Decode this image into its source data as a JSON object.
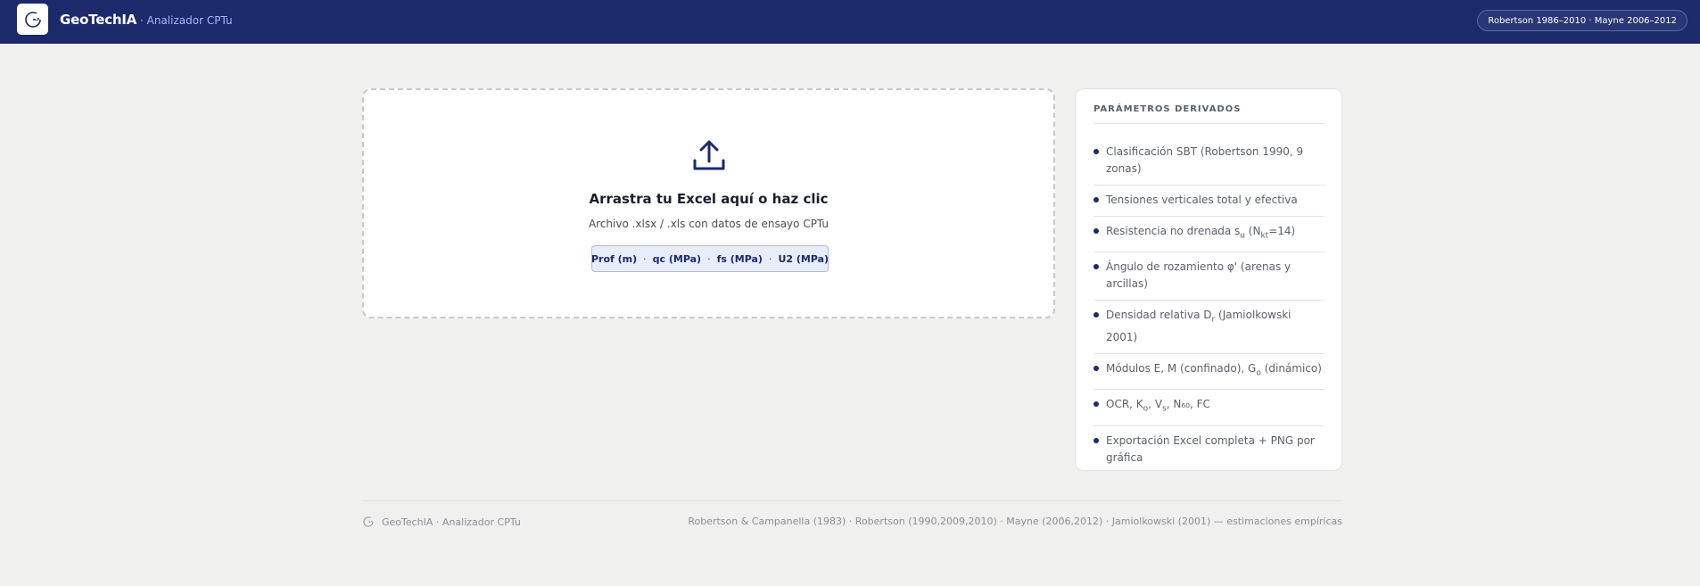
{
  "header": {
    "brand": "GeoTechIA",
    "subtitle": "· Analizador CPTu",
    "references_badge": "Robertson 1986–2010 · Mayne 2006–2012",
    "bar_color": "#1c2a6b"
  },
  "upload": {
    "title": "Arrastra tu Excel aquí o haz clic",
    "subtitle": "Archivo .xlsx / .xls con datos de ensayo CPTu",
    "icon": "upload-icon",
    "columns": [
      "Prof (m)",
      "qc (MPa)",
      "fs (MPa)",
      "U2 (MPa)"
    ],
    "column_separator": "·"
  },
  "panel": {
    "title": "PARÁMETROS DERIVADOS",
    "items": [
      {
        "text": "Clasificación SBT (Robertson 1990, 9 zonas)"
      },
      {
        "text": "Tensiones verticales total y efectiva"
      },
      {
        "pre": "Resistencia no drenada s",
        "sub1": "u",
        "mid": " (N",
        "sub2": "kt",
        "post": "=14)"
      },
      {
        "text": "Ángulo de rozamiento φ' (arenas y arcillas)"
      },
      {
        "pre": "Densidad relativa D",
        "sub1": "r",
        "post": " (Jamiolkowski 2001)"
      },
      {
        "pre": "Módulos E, M (confinado), G",
        "sub1": "o",
        "post": " (dinámico)"
      },
      {
        "pre": "OCR, K",
        "sub1": "o",
        "mid": ", V",
        "sub2": "s",
        "post": ", N₆₀, FC"
      },
      {
        "text": "Exportación Excel completa + PNG por gráfica"
      }
    ]
  },
  "footer": {
    "left": "GeoTechIA · Analizador CPTu",
    "right": "Robertson & Campanella (1983) · Robertson (1990,2009,2010) · Mayne (2006,2012) · Jamiolkowski (2001) — estimaciones empíricas"
  }
}
